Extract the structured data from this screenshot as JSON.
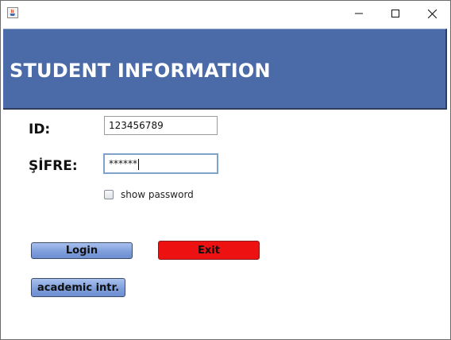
{
  "window": {
    "title": "",
    "controls": {
      "minimize_icon": "minimize-icon",
      "maximize_icon": "maximize-icon",
      "close_icon": "close-icon"
    }
  },
  "header": {
    "title": "STUDENT INFORMATION",
    "background_color": "#4a6aa8"
  },
  "form": {
    "id_label": "ID:",
    "id_value": "123456789",
    "password_label": "ŞİFRE:",
    "password_value": "******",
    "show_password_label": "show password",
    "show_password_checked": false
  },
  "buttons": {
    "login": "Login",
    "exit": "Exit",
    "academic": "academic intr."
  },
  "colors": {
    "exit_button": "#ee1111",
    "blue_button": "#7f9fdc"
  }
}
